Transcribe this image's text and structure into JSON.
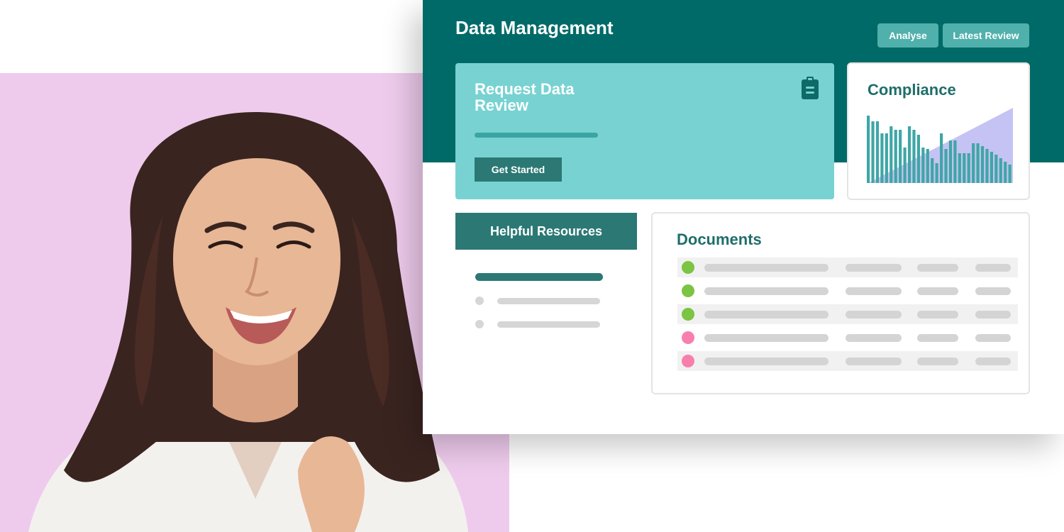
{
  "app": {
    "title": "Data Management",
    "colors": {
      "header": "#006a68",
      "accent": "#4fb0ac",
      "card": "#78d2d2",
      "dark": "#2b7874"
    },
    "header_buttons": [
      {
        "label": "Analyse"
      },
      {
        "label": "Latest Review"
      }
    ]
  },
  "request_card": {
    "title": "Request Data Review",
    "button_label": "Get Started",
    "icon": "clipboard-icon"
  },
  "compliance_card": {
    "title": "Compliance"
  },
  "resources": {
    "title": "Helpful Resources"
  },
  "documents": {
    "title": "Documents",
    "rows": [
      {
        "status": "green",
        "color": "#7cc443"
      },
      {
        "status": "green",
        "color": "#7cc443"
      },
      {
        "status": "green",
        "color": "#7cc443"
      },
      {
        "status": "pink",
        "color": "#f77fae"
      },
      {
        "status": "pink",
        "color": "#f77fae"
      }
    ]
  },
  "chart_data": {
    "type": "bar",
    "title": "",
    "series": [
      {
        "values": [
          95,
          87,
          87,
          70,
          70,
          80,
          75,
          75,
          50,
          80,
          75,
          68,
          50,
          48,
          35,
          28,
          70,
          48,
          60,
          60,
          42,
          42,
          42,
          56,
          56,
          52,
          48,
          44,
          40,
          35,
          30,
          26
        ]
      }
    ],
    "area": [
      10,
      14,
      18,
      22,
      26,
      30,
      34,
      38,
      42,
      46,
      50,
      54,
      58,
      62,
      66,
      70,
      74,
      78,
      82,
      86,
      90,
      94,
      98,
      102,
      106
    ],
    "colors": {
      "bars": "#3fa6a6",
      "area": "#c5c3f3"
    }
  }
}
